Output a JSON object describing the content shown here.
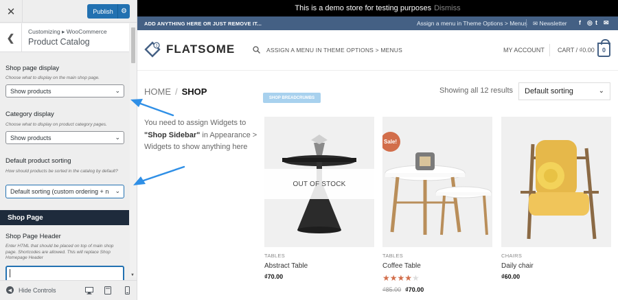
{
  "customizer": {
    "publish_label": "Publish",
    "breadcrumb": "Customizing ▸ WooCommerce",
    "title": "Product Catalog",
    "fields": {
      "shop_display": {
        "label": "Shop page display",
        "description": "Choose what to display on the main shop page.",
        "value": "Show products"
      },
      "category_display": {
        "label": "Category display",
        "description": "Choose what to display on product category pages.",
        "value": "Show products"
      },
      "default_sorting": {
        "label": "Default product sorting",
        "description": "How should products be sorted in the catalog by default?",
        "value": "Default sorting (custom ordering + n"
      }
    },
    "section_title": "Shop Page",
    "shop_header": {
      "label": "Shop Page Header",
      "description": "Enter HTML that should be placed on top of main shop page. Shortcodes are allowed. This will replace Shop Homepage Header"
    },
    "hide_controls_label": "Hide Controls"
  },
  "site": {
    "demo_notice": "This is a demo store for testing purposes",
    "demo_dismiss": "Dismiss",
    "topbar_left": "ADD ANYTHING HERE OR JUST REMOVE IT...",
    "topbar_menu": "Assign a menu in Theme Options > Menus",
    "topbar_newsletter": "Newsletter",
    "logo_text": "FLATSOME",
    "nav_menu": "ASSIGN A MENU IN THEME OPTIONS > MENUS",
    "my_account": "MY ACCOUNT",
    "cart_label": "CART / ₫0.00",
    "cart_count": "0",
    "breadcrumb_home": "HOME",
    "breadcrumb_sep": "/",
    "breadcrumb_current": "SHOP",
    "shop_breadcrumbs_tag": "SHOP BREADCRUMBS",
    "result_count": "Showing all 12 results",
    "sorting_value": "Default sorting",
    "sidebar_notice": {
      "part1": "You need to assign Widgets to ",
      "bold": "\"Shop Sidebar\"",
      "part2": " in Appearance > Widgets to show anything here"
    },
    "products": [
      {
        "category": "TABLES",
        "name": "Abstract Table",
        "price": "₫70.00",
        "badge": "OUT OF STOCK"
      },
      {
        "category": "TABLES",
        "name": "Coffee Table",
        "old_price": "₫85.00",
        "price": "₫70.00",
        "badge": "Sale!",
        "rating": 4
      },
      {
        "category": "CHAIRS",
        "name": "Daily chair",
        "price": "₫60.00"
      }
    ]
  },
  "colors": {
    "primary": "#446084",
    "accent": "#d26e4b",
    "wp_blue": "#2271b1",
    "section_dark": "#1e2b3c"
  }
}
